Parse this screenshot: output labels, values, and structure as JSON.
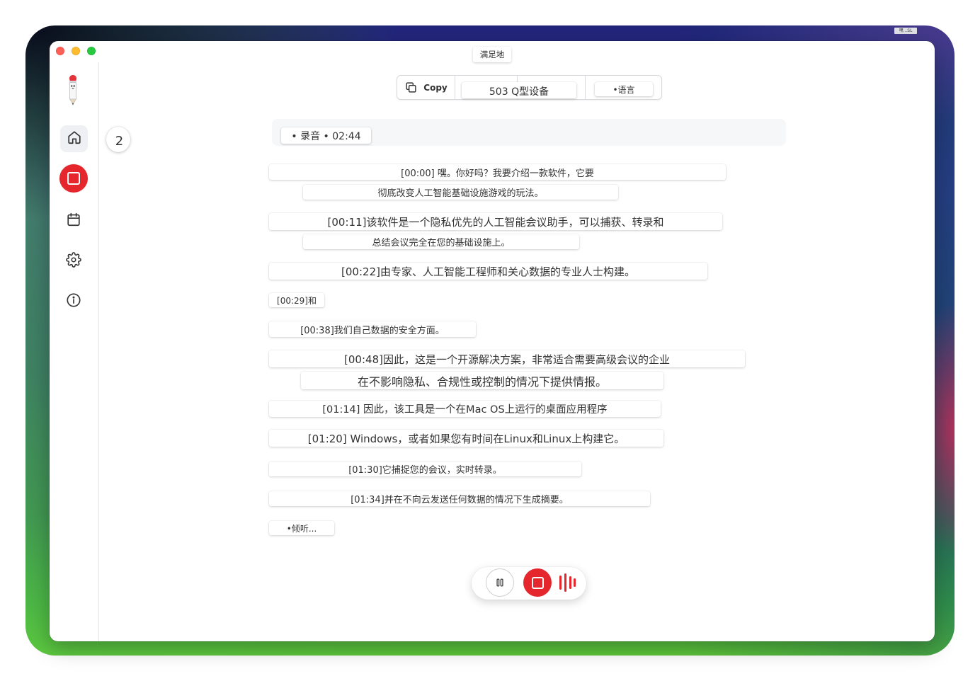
{
  "window": {
    "title_tooltip": "满足地",
    "corner_badge": "嘿...SL"
  },
  "sidebar": {
    "logo_icon": "pencil-mascot-icon",
    "nav": [
      "home-icon",
      "stop-recording-icon",
      "calendar-icon",
      "gear-icon",
      "info-icon"
    ],
    "active_index": 0,
    "badge_count": "2"
  },
  "toolbar": {
    "copy_icon": "copy-icon",
    "copy_label": "Copy",
    "device_label": "503 Q型设备",
    "language_label": "•语言"
  },
  "recording": {
    "status": "• 录音 • 02:44"
  },
  "transcript": [
    "[00:00] 嘿。你好吗？我要介绍一款软件，它要",
    "彻底改变人工智能基础设施游戏的玩法。",
    "[00:11]该软件是一个隐私优先的人工智能会议助手，可以捕获、转录和",
    "总结会议完全在您的基础设施上。",
    "[00:22]由专家、人工智能工程师和关心数据的专业人士构建。",
    "[00:29]和",
    "[00:38]我们自己数据的安全方面。",
    "[00:48]因此，这是一个开源解决方案，非常适合需要高级会议的企业",
    "在不影响隐私、合规性或控制的情况下提供情报。",
    "[01:14] 因此，该工具是一个在Mac OS上运行的桌面应用程序",
    "[01:20] Windows，或者如果您有时间在Linux和Linux上构建它。",
    "[01:30]它捕捉您的会议，实时转录。",
    "[01:34]并在不向云发送任何数据的情况下生成摘要。"
  ],
  "listening_label": "•倾听...",
  "controls": {
    "pause_icon": "pause-icon",
    "stop_icon": "stop-icon",
    "waveform_icon": "waveform-icon"
  },
  "colors": {
    "accent_red": "#e5262c",
    "traffic_close": "#ff5f57",
    "traffic_minimize": "#febc2e",
    "traffic_zoom": "#28c840"
  }
}
